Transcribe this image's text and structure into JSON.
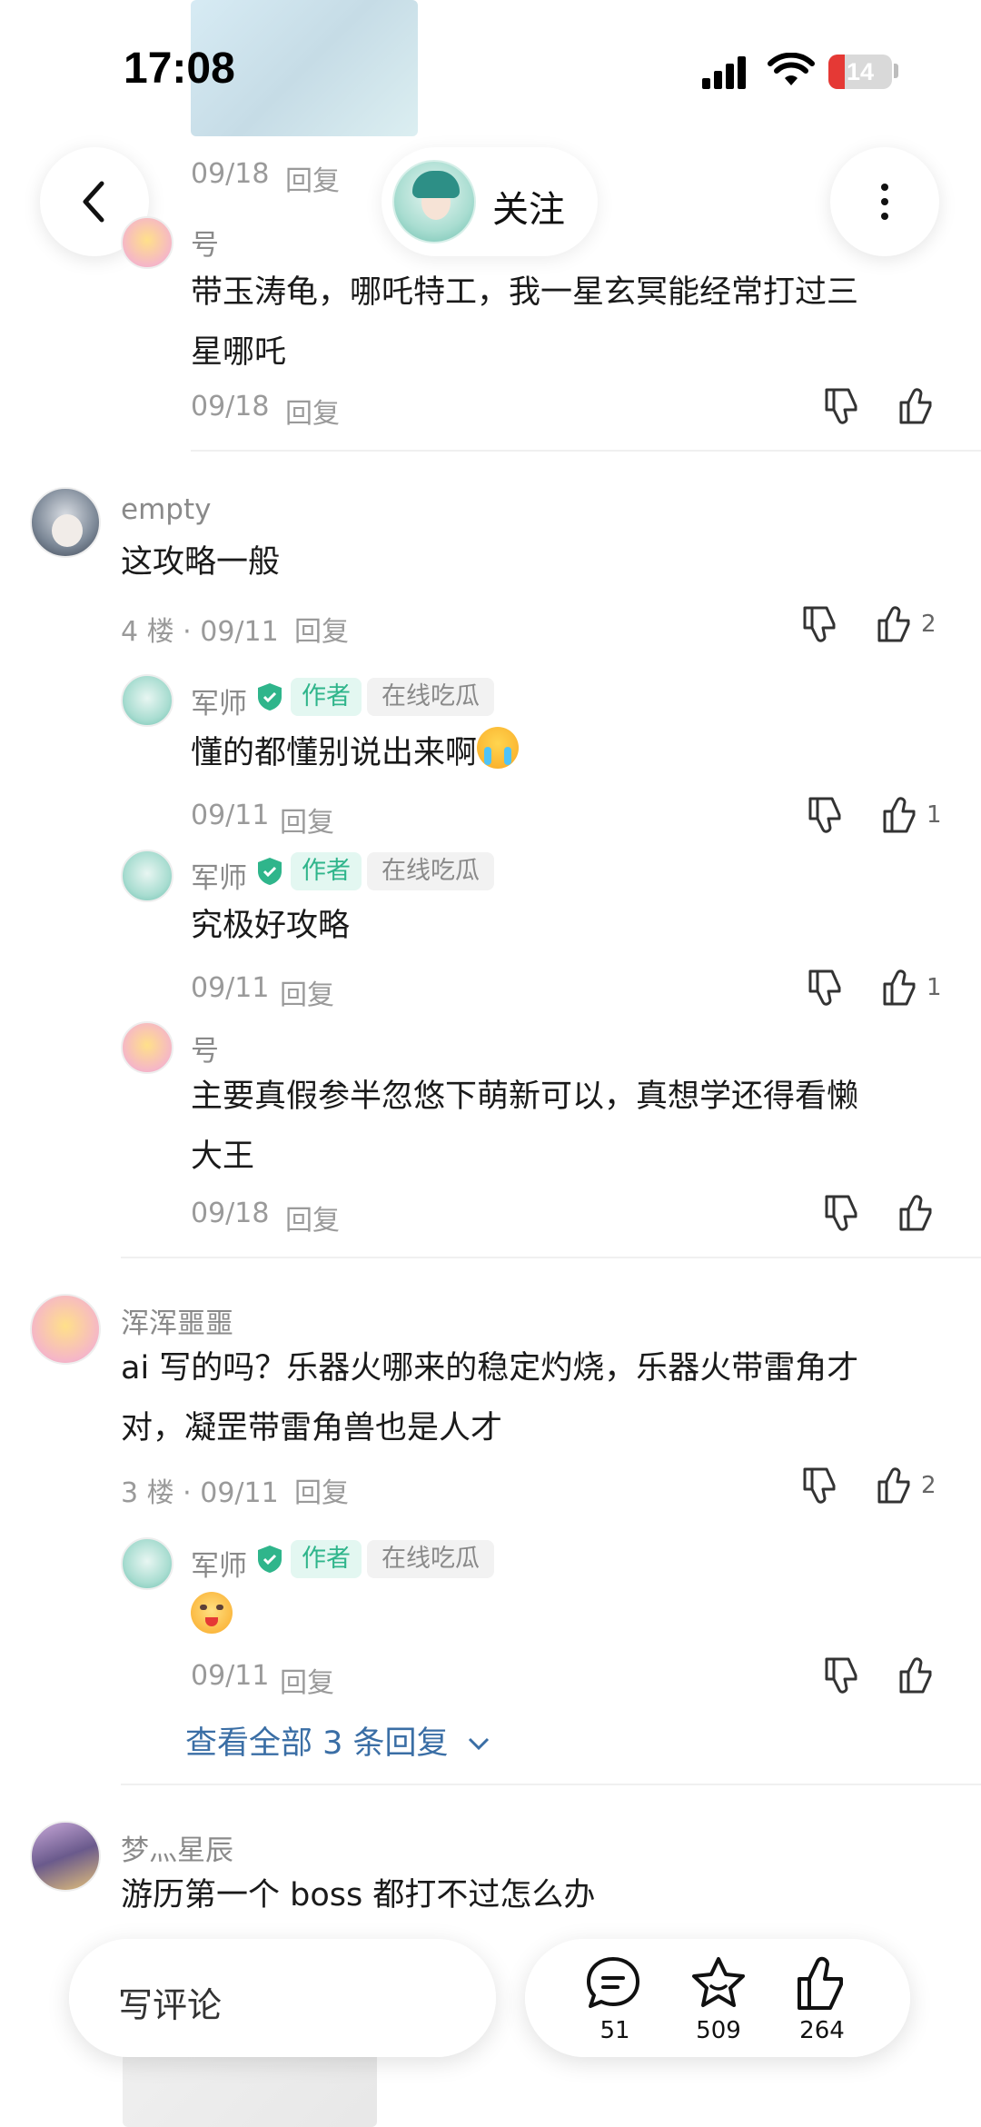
{
  "status_bar": {
    "time": "17:08",
    "battery": "14"
  },
  "header": {
    "follow_label": "关注"
  },
  "reply_label": "回复",
  "comments": [
    {
      "floor_prefix": "",
      "username": "号",
      "text_line1": "带玉涛龟，哪吒特工，我一星玄冥能经常打过三",
      "text_line2": "星哪吒",
      "date": "09/18",
      "top_meta_date": "09/18"
    },
    {
      "username": "empty",
      "text": "这攻略一般",
      "floor_meta": "4 楼 · 09/11",
      "likes": "2",
      "replies": [
        {
          "username": "军师",
          "author_badge": "作者",
          "title_badge": "在线吃瓜",
          "text": "懂的都懂别说出来啊",
          "date": "09/11",
          "likes": "1"
        },
        {
          "username": "军师",
          "author_badge": "作者",
          "title_badge": "在线吃瓜",
          "text": "究极好攻略",
          "date": "09/11",
          "likes": "1"
        },
        {
          "username": "号",
          "text_line1": "主要真假参半忽悠下萌新可以，真想学还得看懒",
          "text_line2": "大王",
          "date": "09/18"
        }
      ]
    },
    {
      "username": "浑浑噩噩",
      "text_line1": "ai 写的吗？乐器火哪来的稳定灼烧，乐器火带雷角才",
      "text_line2": "对，凝罡带雷角兽也是人才",
      "floor_meta": "3 楼 · 09/11",
      "likes": "2",
      "replies": [
        {
          "username": "军师",
          "author_badge": "作者",
          "title_badge": "在线吃瓜",
          "date": "09/11"
        }
      ],
      "view_all": "查看全部 3 条回复"
    },
    {
      "username": "梦灬星辰",
      "text": "游历第一个 boss 都打不过怎么办"
    }
  ],
  "bottom_bar": {
    "write_placeholder": "写评论",
    "comment_count": "51",
    "favorite_count": "509",
    "like_count": "264"
  },
  "colors": {
    "accent_blue": "#3a6ea5",
    "author_green": "#2fb58b"
  }
}
